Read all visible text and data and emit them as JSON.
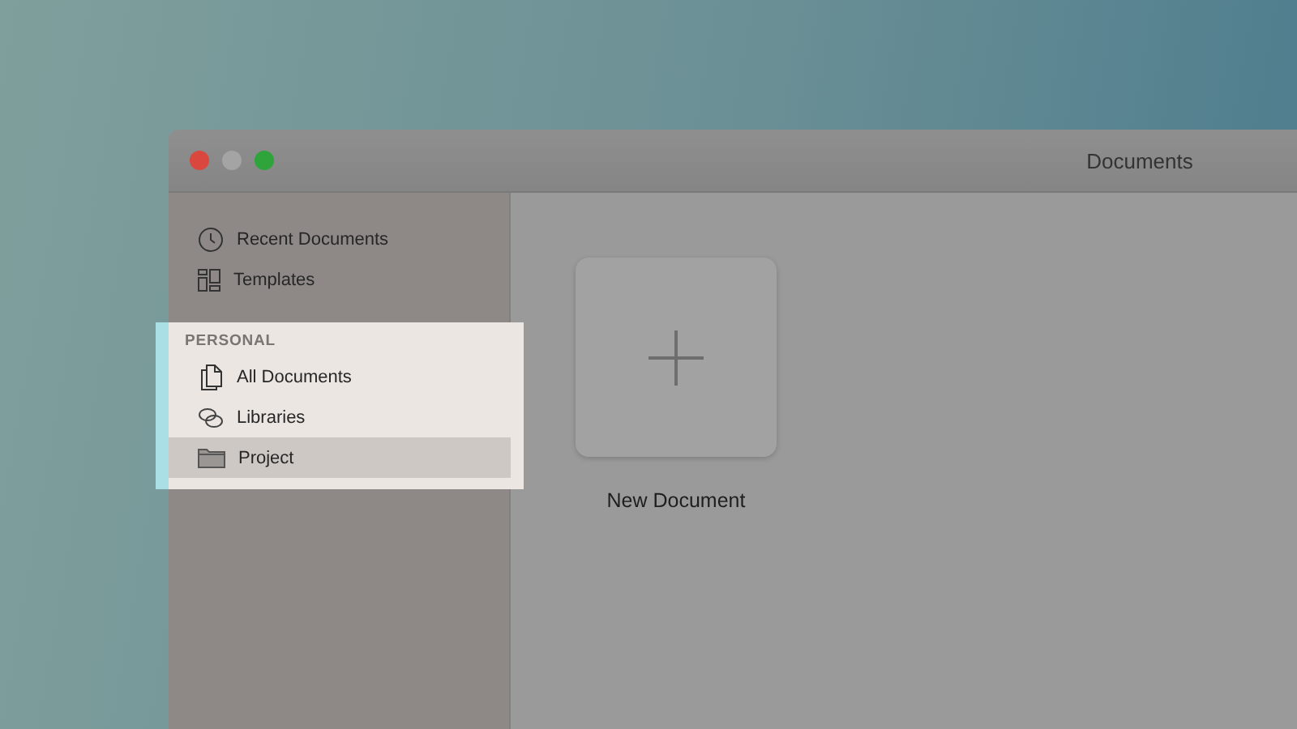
{
  "window": {
    "title": "Documents"
  },
  "sidebar": {
    "items": [
      {
        "label": "Recent Documents",
        "selected": false
      },
      {
        "label": "Templates",
        "selected": false
      }
    ],
    "sections": [
      {
        "title": "PERSONAL",
        "highlighted": true,
        "items": [
          {
            "label": "All Documents",
            "selected": false
          },
          {
            "label": "Libraries",
            "selected": false
          },
          {
            "label": "Project",
            "selected": true
          }
        ]
      }
    ]
  },
  "new_document": {
    "label": "New Document"
  }
}
